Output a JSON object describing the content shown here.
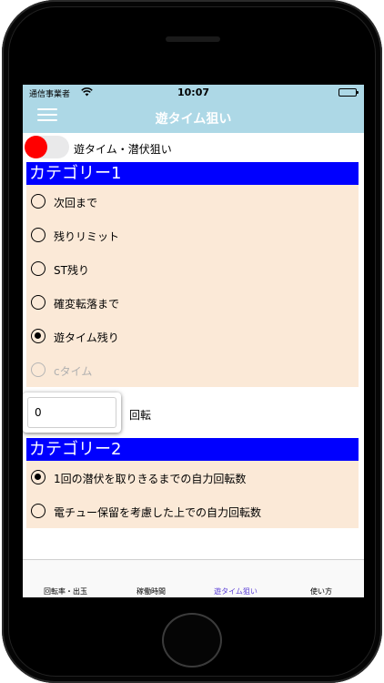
{
  "status_bar": {
    "carrier": "通信事業者",
    "time": "10:07"
  },
  "nav": {
    "title": "遊タイム狙い",
    "menu_icon": "hamburger-menu-icon"
  },
  "toggle": {
    "label": "遊タイム・潜伏狙い",
    "on": false,
    "knob_color": "#ff0000"
  },
  "category1": {
    "title": "カテゴリー1",
    "options": [
      {
        "label": "次回まで",
        "selected": false,
        "disabled": false
      },
      {
        "label": "残りリミット",
        "selected": false,
        "disabled": false
      },
      {
        "label": "ST残り",
        "selected": false,
        "disabled": false
      },
      {
        "label": "確変転落まで",
        "selected": false,
        "disabled": false
      },
      {
        "label": "遊タイム残り",
        "selected": true,
        "disabled": false
      },
      {
        "label": "cタイム",
        "selected": false,
        "disabled": true
      }
    ]
  },
  "count_input": {
    "value": "0",
    "unit": "回転"
  },
  "category2": {
    "title": "カテゴリー2",
    "options": [
      {
        "label": "1回の潜伏を取りきるまでの自力回転数",
        "selected": true,
        "disabled": false
      },
      {
        "label": "電チュー保留を考慮した上での自力回転数",
        "selected": false,
        "disabled": false
      }
    ]
  },
  "tabs": [
    {
      "label": "回転率・出玉",
      "active": false
    },
    {
      "label": "稼働時間",
      "active": false
    },
    {
      "label": "遊タイム狙い",
      "active": true
    },
    {
      "label": "使い方",
      "active": false
    }
  ],
  "colors": {
    "nav_bar": "#add8e6",
    "category_header": "#0000ff",
    "list_background": "#fbe9d7",
    "active_tab": "#5b3fd6"
  }
}
